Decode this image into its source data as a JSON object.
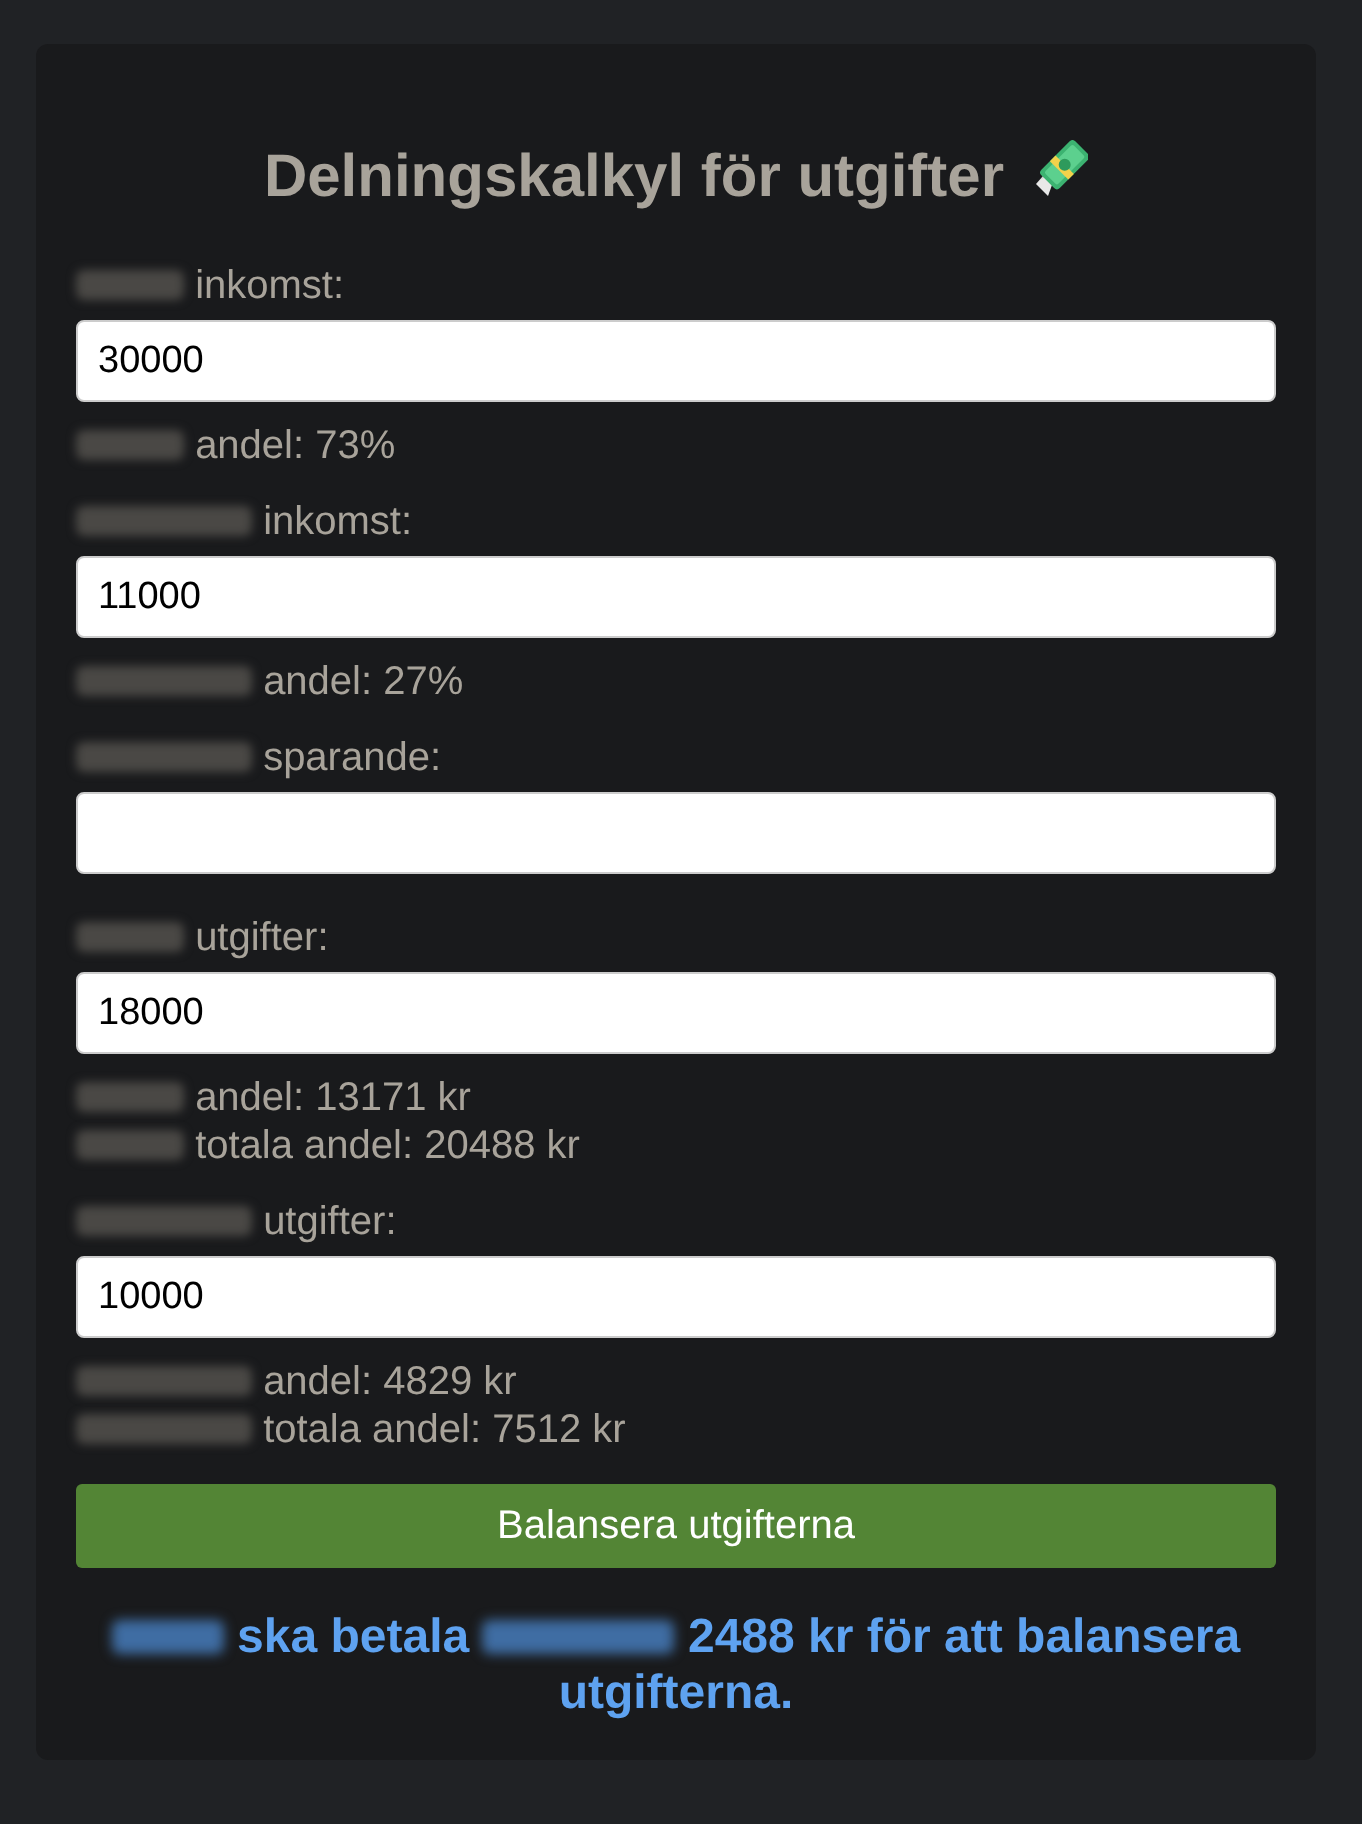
{
  "title": {
    "text": "Delningskalkyl för utgifter",
    "emoji": true
  },
  "fields": [
    {
      "label": {
        "long_name": false,
        "text": "inkomst:"
      },
      "value": "30000",
      "outputs": [
        {
          "long_name": false,
          "text": "andel: 73%"
        }
      ]
    },
    {
      "label": {
        "long_name": true,
        "text": "inkomst:"
      },
      "value": "11000",
      "outputs": [
        {
          "long_name": true,
          "text": "andel: 27%"
        }
      ]
    },
    {
      "label": {
        "long_name": true,
        "text": "sparande:"
      }
    },
    {
      "label": {
        "long_name": false,
        "text": "utgifter:"
      },
      "value": "18000",
      "outputs": [
        {
          "long_name": false,
          "text": "andel: 13171 kr"
        },
        {
          "long_name": false,
          "text": "totala andel: 20488 kr"
        }
      ]
    },
    {
      "label": {
        "long_name": true,
        "text": "utgifter:"
      },
      "value": "10000",
      "outputs": [
        {
          "long_name": true,
          "text": "andel: 4829 kr"
        },
        {
          "long_name": true,
          "text": "totala andel: 7512 kr"
        }
      ]
    }
  ],
  "button": {
    "label": "Balansera utgifterna"
  },
  "result": {
    "parts": [
      {
        "kind": "blur",
        "long_name": false
      },
      {
        "kind": "text",
        "text": "ska betala"
      },
      {
        "kind": "blur",
        "long_name": true
      },
      {
        "kind": "text",
        "text": "2488 kr för att balansera utgifterna."
      }
    ]
  }
}
